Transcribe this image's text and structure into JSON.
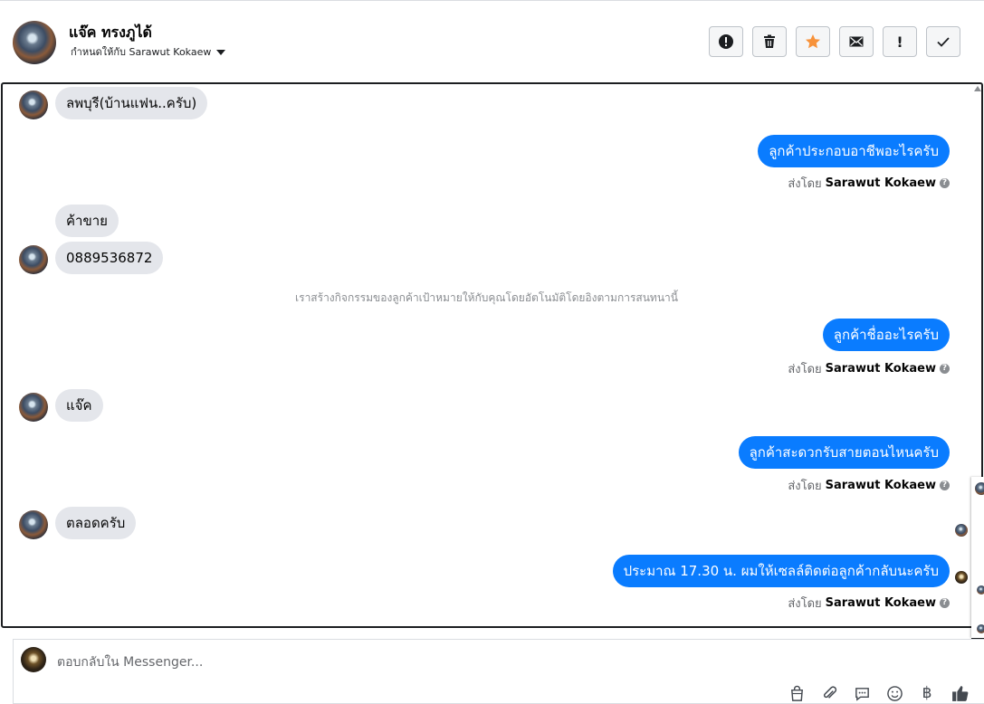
{
  "header": {
    "contact_name": "แจ๊ค ทรงภูได้",
    "assigned_to": "กำหนดให้กับ Sarawut Kokaew",
    "tools": [
      {
        "icon": "alert-circle-icon"
      },
      {
        "icon": "trash-icon"
      },
      {
        "icon": "star-icon",
        "color": "#f7923a"
      },
      {
        "icon": "mail-icon"
      },
      {
        "icon": "exclamation-icon",
        "label": "!"
      },
      {
        "icon": "checkmark-icon"
      }
    ]
  },
  "chat": {
    "messages": [
      {
        "from": "customer",
        "text": "ลพบุรี(บ้านแฟน..ครับ)"
      },
      {
        "from": "page",
        "text": "ลูกค้าประกอบอาชีพอะไรครับ",
        "sent_by_prefix": "ส่งโดย",
        "sent_by_name": "Sarawut Kokaew"
      },
      {
        "from": "customer",
        "text": "ค้าขาย"
      },
      {
        "from": "customer",
        "text": "0889536872"
      },
      {
        "from": "system",
        "text": "เราสร้างกิจกรรมของลูกค้าเป้าหมายให้กับคุณโดยอัตโนมัติโดยอิงตามการสนทนานี้"
      },
      {
        "from": "page",
        "text": "ลูกค้าชื่ออะไรครับ",
        "sent_by_prefix": "ส่งโดย",
        "sent_by_name": "Sarawut Kokaew"
      },
      {
        "from": "customer",
        "text": "แจ๊ค"
      },
      {
        "from": "page",
        "text": "ลูกค้าสะดวกรับสายตอนไหนครับ",
        "sent_by_prefix": "ส่งโดย",
        "sent_by_name": "Sarawut Kokaew"
      },
      {
        "from": "customer",
        "text": "ตลอดครับ"
      },
      {
        "from": "page",
        "text": "ประมาณ 17.30 น. ผมให้เซลล์ติดต่อลูกค้ากลับนะครับ",
        "sent_by_prefix": "ส่งโดย",
        "sent_by_name": "Sarawut Kokaew"
      }
    ]
  },
  "reply": {
    "placeholder": "ตอบกลับใน Messenger...",
    "icons": [
      "shopping-bag-icon",
      "paperclip-icon",
      "saved-reply-icon",
      "emoji-icon",
      "baht-icon",
      "thumbs-up-icon"
    ],
    "baht_symbol": "฿"
  },
  "colors": {
    "outgoing_bubble": "#0a7cff",
    "incoming_bubble": "#e4e6eb",
    "star": "#f7923a"
  }
}
